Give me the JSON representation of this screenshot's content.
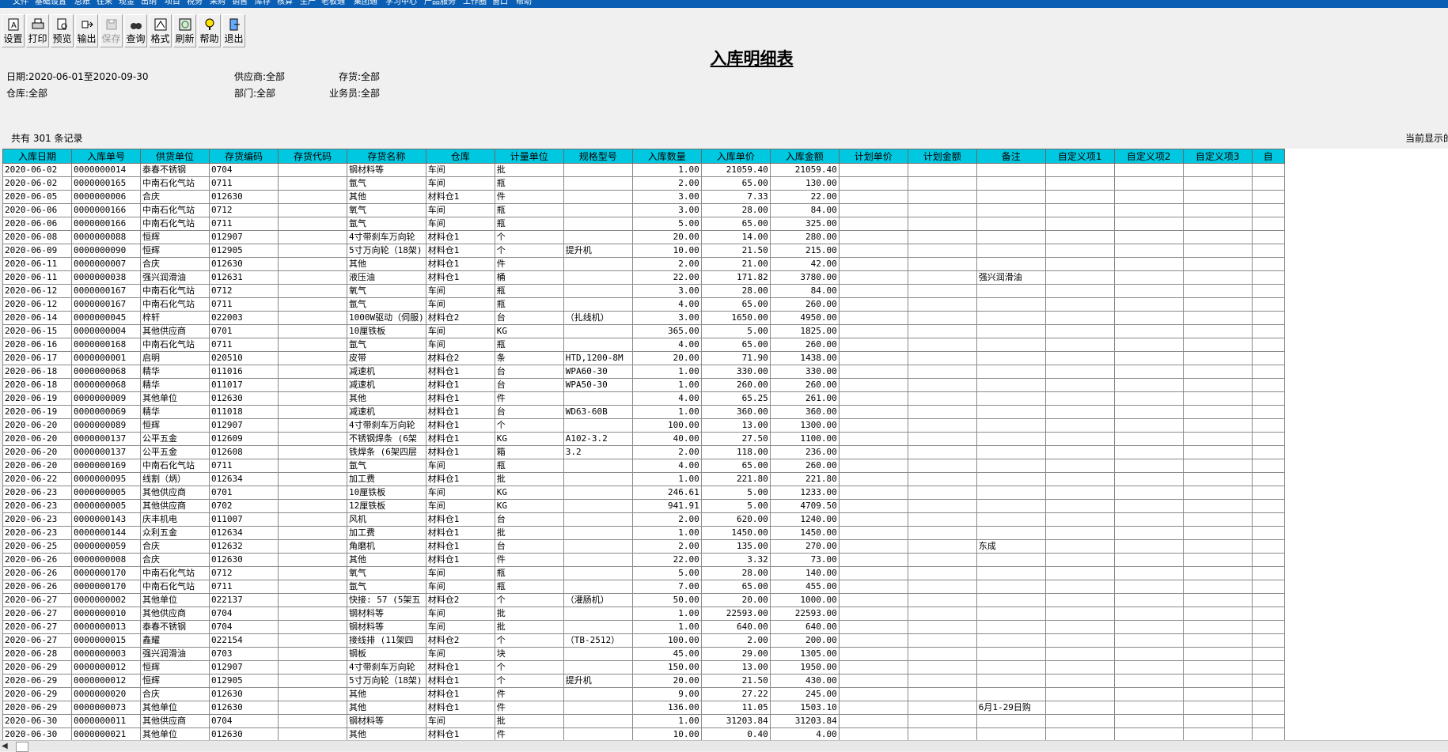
{
  "menu": [
    "文件",
    "基础设置",
    "总账",
    "往来",
    "现金",
    "出纳",
    "项目",
    "税务",
    "采购",
    "销售",
    "库存",
    "核算",
    "生产",
    "老板通",
    "集团通",
    "学习中心",
    "产品服务",
    "工作圈",
    "窗口",
    "帮助"
  ],
  "toolbar": [
    {
      "label": "设置",
      "icon": "settings-icon",
      "enabled": true
    },
    {
      "label": "打印",
      "icon": "print-icon",
      "enabled": true
    },
    {
      "label": "预览",
      "icon": "preview-icon",
      "enabled": true
    },
    {
      "label": "输出",
      "icon": "export-icon",
      "enabled": true
    },
    {
      "label": "保存",
      "icon": "save-icon",
      "enabled": false
    },
    {
      "label": "查询",
      "icon": "query-icon",
      "enabled": true
    },
    {
      "label": "格式",
      "icon": "format-icon",
      "enabled": true
    },
    {
      "label": "刷新",
      "icon": "refresh-icon",
      "enabled": true
    },
    {
      "label": "帮助",
      "icon": "help-icon",
      "enabled": true
    },
    {
      "label": "退出",
      "icon": "exit-icon",
      "enabled": true
    }
  ],
  "report_title": "入库明细表",
  "filters": {
    "date": "日期:2020-06-01至2020-09-30",
    "supplier": "供应商:全部",
    "inventory": "存货:全部",
    "warehouse": "仓库:全部",
    "department": "部门:全部",
    "salesman": "业务员:全部"
  },
  "record_count": "共有 301 条记录",
  "current_display": "当前显示的",
  "columns": [
    "入库日期",
    "入库单号",
    "供货单位",
    "存货编码",
    "存货代码",
    "存货名称",
    "仓库",
    "计量单位",
    "规格型号",
    "入库数量",
    "入库单价",
    "入库金额",
    "计划单价",
    "计划金额",
    "备注",
    "自定义项1",
    "自定义项2",
    "自定义项3",
    "自"
  ],
  "rows": [
    [
      "2020-06-02",
      "0000000014",
      "泰春不锈钢",
      "0704",
      "",
      "钢材料等",
      "车间",
      "批",
      "",
      "1.00",
      "21059.40",
      "21059.40",
      "",
      "",
      "",
      "",
      "",
      ""
    ],
    [
      "2020-06-02",
      "0000000165",
      "中南石化气站",
      "0711",
      "",
      "氩气",
      "车间",
      "瓶",
      "",
      "2.00",
      "65.00",
      "130.00",
      "",
      "",
      "",
      "",
      "",
      ""
    ],
    [
      "2020-06-05",
      "0000000006",
      "合庆",
      "012630",
      "",
      "其他",
      "材料仓1",
      "件",
      "",
      "3.00",
      "7.33",
      "22.00",
      "",
      "",
      "",
      "",
      "",
      ""
    ],
    [
      "2020-06-06",
      "0000000166",
      "中南石化气站",
      "0712",
      "",
      "氧气",
      "车间",
      "瓶",
      "",
      "3.00",
      "28.00",
      "84.00",
      "",
      "",
      "",
      "",
      "",
      ""
    ],
    [
      "2020-06-06",
      "0000000166",
      "中南石化气站",
      "0711",
      "",
      "氩气",
      "车间",
      "瓶",
      "",
      "5.00",
      "65.00",
      "325.00",
      "",
      "",
      "",
      "",
      "",
      ""
    ],
    [
      "2020-06-08",
      "0000000088",
      "恒辉",
      "012907",
      "",
      "4寸带刹车万向轮",
      "材料仓1",
      "个",
      "",
      "20.00",
      "14.00",
      "280.00",
      "",
      "",
      "",
      "",
      "",
      ""
    ],
    [
      "2020-06-09",
      "0000000090",
      "恒辉",
      "012905",
      "",
      "5寸万向轮（18架)",
      "材料仓1",
      "个",
      "提升机",
      "10.00",
      "21.50",
      "215.00",
      "",
      "",
      "",
      "",
      "",
      ""
    ],
    [
      "2020-06-11",
      "0000000007",
      "合庆",
      "012630",
      "",
      "其他",
      "材料仓1",
      "件",
      "",
      "2.00",
      "21.00",
      "42.00",
      "",
      "",
      "",
      "",
      "",
      ""
    ],
    [
      "2020-06-11",
      "0000000038",
      "强兴润滑油",
      "012631",
      "",
      "液压油",
      "材料仓1",
      "桶",
      "",
      "22.00",
      "171.82",
      "3780.00",
      "",
      "",
      "强兴润滑油",
      "",
      "",
      ""
    ],
    [
      "2020-06-12",
      "0000000167",
      "中南石化气站",
      "0712",
      "",
      "氧气",
      "车间",
      "瓶",
      "",
      "3.00",
      "28.00",
      "84.00",
      "",
      "",
      "",
      "",
      "",
      ""
    ],
    [
      "2020-06-12",
      "0000000167",
      "中南石化气站",
      "0711",
      "",
      "氩气",
      "车间",
      "瓶",
      "",
      "4.00",
      "65.00",
      "260.00",
      "",
      "",
      "",
      "",
      "",
      ""
    ],
    [
      "2020-06-14",
      "0000000045",
      "梓轩",
      "022003",
      "",
      "1000W驱动（伺服)",
      "材料仓2",
      "台",
      "（扎线机）",
      "3.00",
      "1650.00",
      "4950.00",
      "",
      "",
      "",
      "",
      "",
      ""
    ],
    [
      "2020-06-15",
      "0000000004",
      "其他供应商",
      "0701",
      "",
      "10厘铁板",
      "车间",
      "KG",
      "",
      "365.00",
      "5.00",
      "1825.00",
      "",
      "",
      "",
      "",
      "",
      ""
    ],
    [
      "2020-06-16",
      "0000000168",
      "中南石化气站",
      "0711",
      "",
      "氩气",
      "车间",
      "瓶",
      "",
      "4.00",
      "65.00",
      "260.00",
      "",
      "",
      "",
      "",
      "",
      ""
    ],
    [
      "2020-06-17",
      "0000000001",
      "启明",
      "020510",
      "",
      "皮带",
      "材料仓2",
      "条",
      "HTD,1200-8M",
      "20.00",
      "71.90",
      "1438.00",
      "",
      "",
      "",
      "",
      "",
      ""
    ],
    [
      "2020-06-18",
      "0000000068",
      "精华",
      "011016",
      "",
      "减速机",
      "材料仓1",
      "台",
      "WPA60-30",
      "1.00",
      "330.00",
      "330.00",
      "",
      "",
      "",
      "",
      "",
      ""
    ],
    [
      "2020-06-18",
      "0000000068",
      "精华",
      "011017",
      "",
      "减速机",
      "材料仓1",
      "台",
      "WPA50-30",
      "1.00",
      "260.00",
      "260.00",
      "",
      "",
      "",
      "",
      "",
      ""
    ],
    [
      "2020-06-19",
      "0000000009",
      "其他单位",
      "012630",
      "",
      "其他",
      "材料仓1",
      "件",
      "",
      "4.00",
      "65.25",
      "261.00",
      "",
      "",
      "",
      "",
      "",
      ""
    ],
    [
      "2020-06-19",
      "0000000069",
      "精华",
      "011018",
      "",
      "减速机",
      "材料仓1",
      "台",
      "WD63-60B",
      "1.00",
      "360.00",
      "360.00",
      "",
      "",
      "",
      "",
      "",
      ""
    ],
    [
      "2020-06-20",
      "0000000089",
      "恒辉",
      "012907",
      "",
      "4寸带刹车万向轮",
      "材料仓1",
      "个",
      "",
      "100.00",
      "13.00",
      "1300.00",
      "",
      "",
      "",
      "",
      "",
      ""
    ],
    [
      "2020-06-20",
      "0000000137",
      "公平五金",
      "012609",
      "",
      "不锈钢焊条 (6架",
      "材料仓1",
      "KG",
      "A102-3.2",
      "40.00",
      "27.50",
      "1100.00",
      "",
      "",
      "",
      "",
      "",
      ""
    ],
    [
      "2020-06-20",
      "0000000137",
      "公平五金",
      "012608",
      "",
      "铁焊条 (6架四层",
      "材料仓1",
      "箱",
      "3.2",
      "2.00",
      "118.00",
      "236.00",
      "",
      "",
      "",
      "",
      "",
      ""
    ],
    [
      "2020-06-20",
      "0000000169",
      "中南石化气站",
      "0711",
      "",
      "氩气",
      "车间",
      "瓶",
      "",
      "4.00",
      "65.00",
      "260.00",
      "",
      "",
      "",
      "",
      "",
      ""
    ],
    [
      "2020-06-22",
      "0000000095",
      "线割（炳）",
      "012634",
      "",
      "加工费",
      "材料仓1",
      "批",
      "",
      "1.00",
      "221.80",
      "221.80",
      "",
      "",
      "",
      "",
      "",
      ""
    ],
    [
      "2020-06-23",
      "0000000005",
      "其他供应商",
      "0701",
      "",
      "10厘铁板",
      "车间",
      "KG",
      "",
      "246.61",
      "5.00",
      "1233.00",
      "",
      "",
      "",
      "",
      "",
      ""
    ],
    [
      "2020-06-23",
      "0000000005",
      "其他供应商",
      "0702",
      "",
      "12厘铁板",
      "车间",
      "KG",
      "",
      "941.91",
      "5.00",
      "4709.50",
      "",
      "",
      "",
      "",
      "",
      ""
    ],
    [
      "2020-06-23",
      "0000000143",
      "庆丰机电",
      "011007",
      "",
      "风机",
      "材料仓1",
      "台",
      "",
      "2.00",
      "620.00",
      "1240.00",
      "",
      "",
      "",
      "",
      "",
      ""
    ],
    [
      "2020-06-23",
      "0000000144",
      "众利五金",
      "012634",
      "",
      "加工费",
      "材料仓1",
      "批",
      "",
      "1.00",
      "1450.00",
      "1450.00",
      "",
      "",
      "",
      "",
      "",
      ""
    ],
    [
      "2020-06-25",
      "0000000059",
      "合庆",
      "012632",
      "",
      "角磨机",
      "材料仓1",
      "台",
      "",
      "2.00",
      "135.00",
      "270.00",
      "",
      "",
      "东成",
      "",
      "",
      ""
    ],
    [
      "2020-06-26",
      "0000000008",
      "合庆",
      "012630",
      "",
      "其他",
      "材料仓1",
      "件",
      "",
      "22.00",
      "3.32",
      "73.00",
      "",
      "",
      "",
      "",
      "",
      ""
    ],
    [
      "2020-06-26",
      "0000000170",
      "中南石化气站",
      "0712",
      "",
      "氧气",
      "车间",
      "瓶",
      "",
      "5.00",
      "28.00",
      "140.00",
      "",
      "",
      "",
      "",
      "",
      ""
    ],
    [
      "2020-06-26",
      "0000000170",
      "中南石化气站",
      "0711",
      "",
      "氩气",
      "车间",
      "瓶",
      "",
      "7.00",
      "65.00",
      "455.00",
      "",
      "",
      "",
      "",
      "",
      ""
    ],
    [
      "2020-06-27",
      "0000000002",
      "其他单位",
      "022137",
      "",
      "快接: 57 (5架五",
      "材料仓2",
      "个",
      "（灌肠机）",
      "50.00",
      "20.00",
      "1000.00",
      "",
      "",
      "",
      "",
      "",
      ""
    ],
    [
      "2020-06-27",
      "0000000010",
      "其他供应商",
      "0704",
      "",
      "钢材料等",
      "车间",
      "批",
      "",
      "1.00",
      "22593.00",
      "22593.00",
      "",
      "",
      "",
      "",
      "",
      ""
    ],
    [
      "2020-06-27",
      "0000000013",
      "泰春不锈钢",
      "0704",
      "",
      "钢材料等",
      "车间",
      "批",
      "",
      "1.00",
      "640.00",
      "640.00",
      "",
      "",
      "",
      "",
      "",
      ""
    ],
    [
      "2020-06-27",
      "0000000015",
      "鑫耀",
      "022154",
      "",
      "接线排 (11架四",
      "材料仓2",
      "个",
      "（TB-2512）",
      "100.00",
      "2.00",
      "200.00",
      "",
      "",
      "",
      "",
      "",
      ""
    ],
    [
      "2020-06-28",
      "0000000003",
      "强兴润滑油",
      "0703",
      "",
      "钢板",
      "车间",
      "块",
      "",
      "45.00",
      "29.00",
      "1305.00",
      "",
      "",
      "",
      "",
      "",
      ""
    ],
    [
      "2020-06-29",
      "0000000012",
      "恒辉",
      "012907",
      "",
      "4寸带刹车万向轮",
      "材料仓1",
      "个",
      "",
      "150.00",
      "13.00",
      "1950.00",
      "",
      "",
      "",
      "",
      "",
      ""
    ],
    [
      "2020-06-29",
      "0000000012",
      "恒辉",
      "012905",
      "",
      "5寸万向轮（18架)",
      "材料仓1",
      "个",
      "提升机",
      "20.00",
      "21.50",
      "430.00",
      "",
      "",
      "",
      "",
      "",
      ""
    ],
    [
      "2020-06-29",
      "0000000020",
      "合庆",
      "012630",
      "",
      "其他",
      "材料仓1",
      "件",
      "",
      "9.00",
      "27.22",
      "245.00",
      "",
      "",
      "",
      "",
      "",
      ""
    ],
    [
      "2020-06-29",
      "0000000073",
      "其他单位",
      "012630",
      "",
      "其他",
      "材料仓1",
      "件",
      "",
      "136.00",
      "11.05",
      "1503.10",
      "",
      "",
      "6月1-29日购",
      "",
      "",
      ""
    ],
    [
      "2020-06-30",
      "0000000011",
      "其他供应商",
      "0704",
      "",
      "钢材料等",
      "车间",
      "批",
      "",
      "1.00",
      "31203.84",
      "31203.84",
      "",
      "",
      "",
      "",
      "",
      ""
    ],
    [
      "2020-06-30",
      "0000000021",
      "其他单位",
      "012630",
      "",
      "其他",
      "材料仓1",
      "件",
      "",
      "10.00",
      "0.40",
      "4.00",
      "",
      "",
      "",
      "",
      "",
      ""
    ]
  ],
  "colors": {
    "header_bg": "#00c8e0",
    "menubar_bg": "#0a5fb4"
  }
}
